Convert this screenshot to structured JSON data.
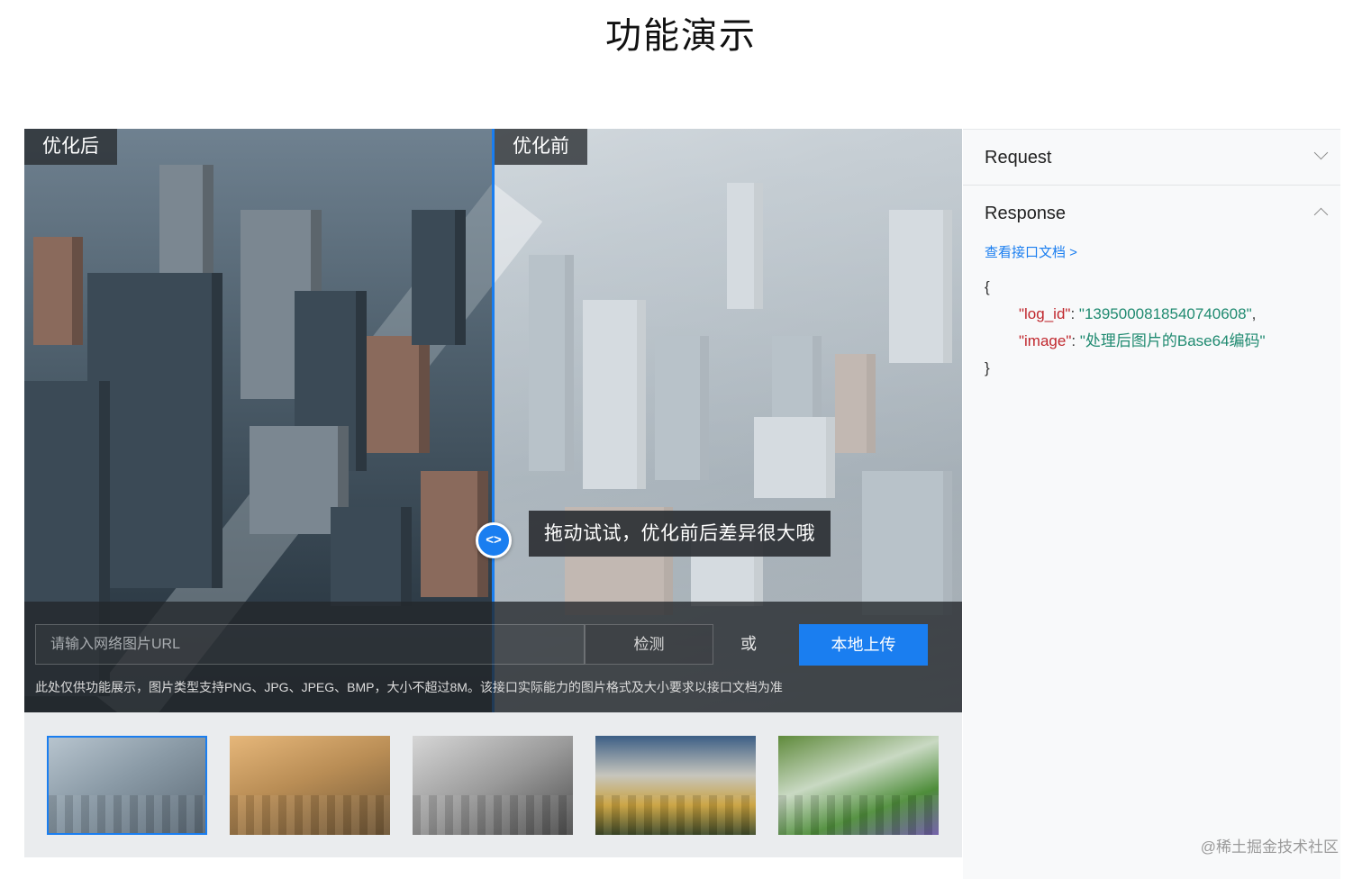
{
  "page": {
    "title": "功能演示"
  },
  "demo": {
    "label_after": "优化后",
    "label_before": "优化前",
    "handle_icon": "<>",
    "hint": "拖动试试，优化前后差异很大哦",
    "url_placeholder": "请输入网络图片URL",
    "detect_label": "检测",
    "or_label": "或",
    "upload_label": "本地上传",
    "note": "此处仅供功能展示，图片类型支持PNG、JPG、JPEG、BMP，大小不超过8M。该接口实际能力的图片格式及大小要求以接口文档为准"
  },
  "thumbnails": [
    {
      "name": "city-haze",
      "selected": true
    },
    {
      "name": "city-orange-haze",
      "selected": false
    },
    {
      "name": "foggy-trees",
      "selected": false
    },
    {
      "name": "foggy-forest",
      "selected": false
    },
    {
      "name": "misty-garden",
      "selected": false
    }
  ],
  "panel": {
    "request_label": "Request",
    "response_label": "Response",
    "doc_link": "查看接口文档 >",
    "open_brace": "{",
    "close_brace": "}",
    "fields": [
      {
        "key": "\"log_id\"",
        "value": "\"1395000818540740608\"",
        "sep": ": ",
        "trail": ","
      },
      {
        "key": "\"image\"",
        "value": "\"处理后图片的Base64编码\"",
        "sep": ": ",
        "trail": ""
      }
    ]
  },
  "watermark": "@稀土掘金技术社区",
  "colors": {
    "accent": "#1a7ef0",
    "json_key": "#c0272d",
    "json_value": "#1f8a70"
  }
}
